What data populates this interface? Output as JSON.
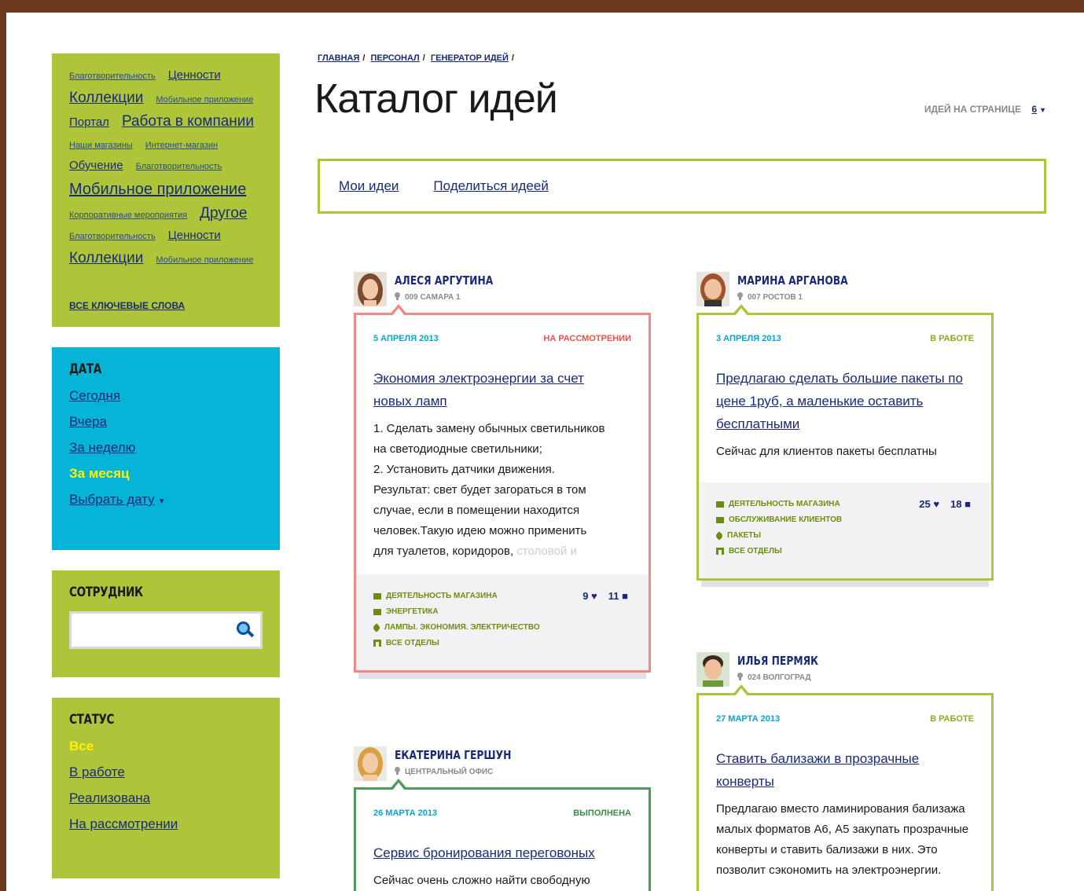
{
  "breadcrumb": [
    "ГЛАВНАЯ",
    "ПЕРСОНАЛ",
    "ГЕНЕРАТОР ИДЕЙ"
  ],
  "page_title": "Каталог идей",
  "per_page": {
    "label": "ИДЕЙ НА СТРАНИЦЕ",
    "value": "6"
  },
  "actions": {
    "my_ideas": "Мои идеи",
    "share": "Поделиться идеей"
  },
  "keywords": {
    "rows": [
      [
        {
          "t": "Благотворительность",
          "s": "s"
        },
        {
          "t": "Ценности",
          "s": "m"
        }
      ],
      [
        {
          "t": "Коллекции",
          "s": "l"
        },
        {
          "t": "Мобильное приложение",
          "s": "s"
        }
      ],
      [
        {
          "t": "Портал",
          "s": "m"
        },
        {
          "t": "Работа в компании",
          "s": "l"
        }
      ],
      [
        {
          "t": "Наши магазины",
          "s": "s"
        },
        {
          "t": "Интернет-магазин",
          "s": "s"
        }
      ],
      [
        {
          "t": "Обучение",
          "s": "m"
        },
        {
          "t": "Благотворительность",
          "s": "s"
        }
      ],
      [
        {
          "t": "Мобильное приложение",
          "s": "xl"
        }
      ],
      [
        {
          "t": "Корпоративные мероприятия",
          "s": "s"
        },
        {
          "t": "Другое",
          "s": "l"
        }
      ],
      [
        {
          "t": "Благотворительность",
          "s": "s"
        },
        {
          "t": "Ценности",
          "s": "m"
        }
      ],
      [
        {
          "t": "Коллекции",
          "s": "l"
        },
        {
          "t": "Мобильное приложение",
          "s": "s"
        }
      ]
    ],
    "all_label": "ВСЕ КЛЮЧЕВЫЕ СЛОВА"
  },
  "date_filter": {
    "title": "ДАТА",
    "items": [
      "Сегодня",
      "Вчера",
      "За неделю",
      "За месяц",
      "Выбрать дату"
    ],
    "active": "За месяц"
  },
  "employee_filter": {
    "title": "СОТРУДНИК",
    "placeholder": ""
  },
  "status_filter": {
    "title": "СТАТУС",
    "items": [
      "Все",
      "В работе",
      "Реализована",
      "На рассмотрении"
    ],
    "active": "Все"
  },
  "ideas": [
    {
      "author": "АЛЕСЯ АРГУТИНА",
      "location": "009 САМАРА 1",
      "date": "5 АПРЕЛЯ 2013",
      "status": "НА РАССМОТРЕНИИ",
      "title": "Экономия электроэнергии за счет новых ламп",
      "text_lines": [
        "1. Сделать замену обычных светильников",
        "на светодиодные светильники;",
        "2. Установить датчики движения.",
        "Результат: свет будет загораться в том",
        " случае, если в помещении находится",
        " человек.Такую идею можно применить",
        " для туалетов, коридоров, "
      ],
      "text_fade": "столовой и",
      "meta": [
        "ДЕЯТЕЛЬНОСТЬ МАГАЗИНА",
        "ЭНЕРГЕТИКА",
        "ЛАМПЫ. ЭКОНОМИЯ. ЭЛЕКТРИЧЕСТВО",
        "ВСЕ ОТДЕЛЫ"
      ],
      "likes": "9",
      "comments": "11"
    },
    {
      "author": "МАРИНА АРГАНОВА",
      "location": "007 РОСТОВ 1",
      "date": "3 АПРЕЛЯ 2013",
      "status": "В РАБОТЕ",
      "title": "Предлагаю сделать большие пакеты по цене 1руб, а маленькие оставить бесплатными",
      "text": "Сейчас для клиентов пакеты бесплатны",
      "meta": [
        "ДЕЯТЕЛЬНОСТЬ МАГАЗИНА",
        "ОБСЛУЖИВАНИЕ КЛИЕНТОВ",
        "ПАКЕТЫ",
        "ВСЕ ОТДЕЛЫ"
      ],
      "likes": "25",
      "comments": "18"
    },
    {
      "author": "ЕКАТЕРИНА ГЕРШУН",
      "location": "ЦЕНТРАЛЬНЫЙ ОФИС",
      "date": "26 МАРТА 2013",
      "status": "ВЫПОЛНЕНА",
      "title": "Сервис бронирования переговоных",
      "text": "Сейчас очень сложно найти свободную"
    },
    {
      "author": "ИЛЬЯ ПЕРМЯК",
      "location": "024 ВОЛГОГРАД",
      "date": "27 МАРТА 2013",
      "status": "В РАБОТЕ",
      "title": "Ставить бализажи в прозрачные конверты",
      "text": "Предлагаю вместо ламинирования бализажа малых форматов А6, А5 закупать прозрачные конверты и ставить бализажи в них. Это позволит сэкономить на электроэнергии."
    }
  ],
  "colors": {
    "lime": "#aec53a",
    "cyan": "#06b4d8",
    "navy": "#1a2a78",
    "status_red": "#e8524a",
    "status_green": "#8aab20",
    "status_done": "#3b8a4a"
  },
  "icons": [
    "search-icon",
    "pin-icon",
    "folder-icon",
    "tag-icon",
    "org-icon",
    "heart-icon",
    "comment-icon",
    "caret-down-icon"
  ]
}
